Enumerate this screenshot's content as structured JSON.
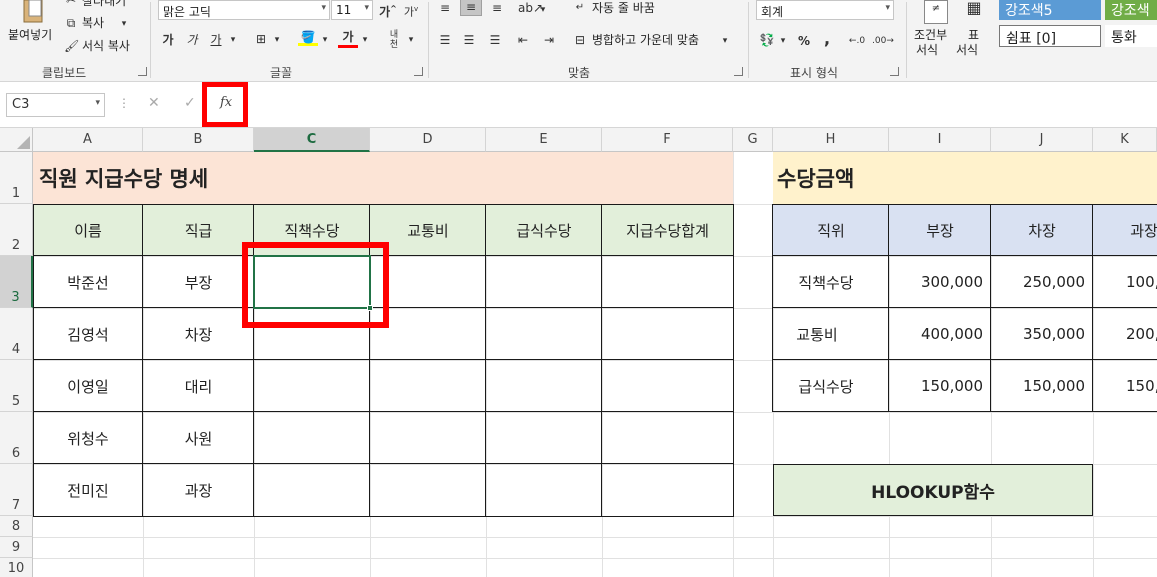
{
  "ribbon": {
    "clipboard": {
      "paste_label": "붙여넣기",
      "cut_label": "잘라내기",
      "copy_label": "복사",
      "format_painter_label": "서식 복사",
      "group_label": "클립보드"
    },
    "font": {
      "font_name": "맑은 고딕",
      "font_size": "11",
      "bold": "가",
      "italic": "가",
      "underline": "가",
      "font_color_glyph": "가",
      "grow_glyph": "가",
      "group_label": "글꼴"
    },
    "alignment": {
      "wrap_text": "자동 줄 바꿈",
      "merge_center": "병합하고 가운데 맞춤",
      "group_label": "맞춤"
    },
    "number": {
      "format": "회계",
      "percent": "%",
      "comma": ",",
      "group_label": "표시 형식"
    },
    "styles": {
      "conditional_label": "조건부",
      "conditional_sub": "서식",
      "table_label": "표",
      "table_sub": "서식",
      "accent5": "강조색5",
      "accent6": "강조색",
      "comma0": "쉼표 [0]",
      "currency": "통화"
    }
  },
  "formula_bar": {
    "name_box": "C3",
    "fx": "fx",
    "cancel": "✕",
    "enter": "✓",
    "formula": ""
  },
  "columns": [
    "A",
    "B",
    "C",
    "D",
    "E",
    "F",
    "G",
    "H",
    "I",
    "J",
    "K"
  ],
  "rows": [
    "1",
    "2",
    "3",
    "4",
    "5",
    "6",
    "7",
    "8",
    "9",
    "10"
  ],
  "selected_cell": "C3",
  "left_table": {
    "title": "직원 지급수당 명세",
    "headers": [
      "이름",
      "직급",
      "직책수당",
      "교통비",
      "급식수당",
      "지급수당합계"
    ],
    "rows": [
      [
        "박준선",
        "부장"
      ],
      [
        "김영석",
        "차장"
      ],
      [
        "이영일",
        "대리"
      ],
      [
        "위청수",
        "사원"
      ],
      [
        "전미진",
        "과장"
      ]
    ]
  },
  "right_table": {
    "title": "수당금액",
    "headers": [
      "직위",
      "부장",
      "차장",
      "과장"
    ],
    "rows": [
      {
        "label": "직책수당",
        "values": [
          "300,000",
          "250,000",
          "100,"
        ]
      },
      {
        "label": "교통비",
        "values": [
          "400,000",
          "350,000",
          "200,"
        ]
      },
      {
        "label": "급식수당",
        "values": [
          "150,000",
          "150,000",
          "150,"
        ]
      }
    ],
    "function_label": "HLOOKUP함수"
  },
  "colors": {
    "title_left_bg": "#fce4d6",
    "title_right_bg": "#fff2cc",
    "header_left_bg": "#e2efda",
    "header_right_bg": "#d9e1f2",
    "hlookup_bg": "#e2efda",
    "highlight_red": "#ff0000",
    "selection_green": "#217346"
  }
}
